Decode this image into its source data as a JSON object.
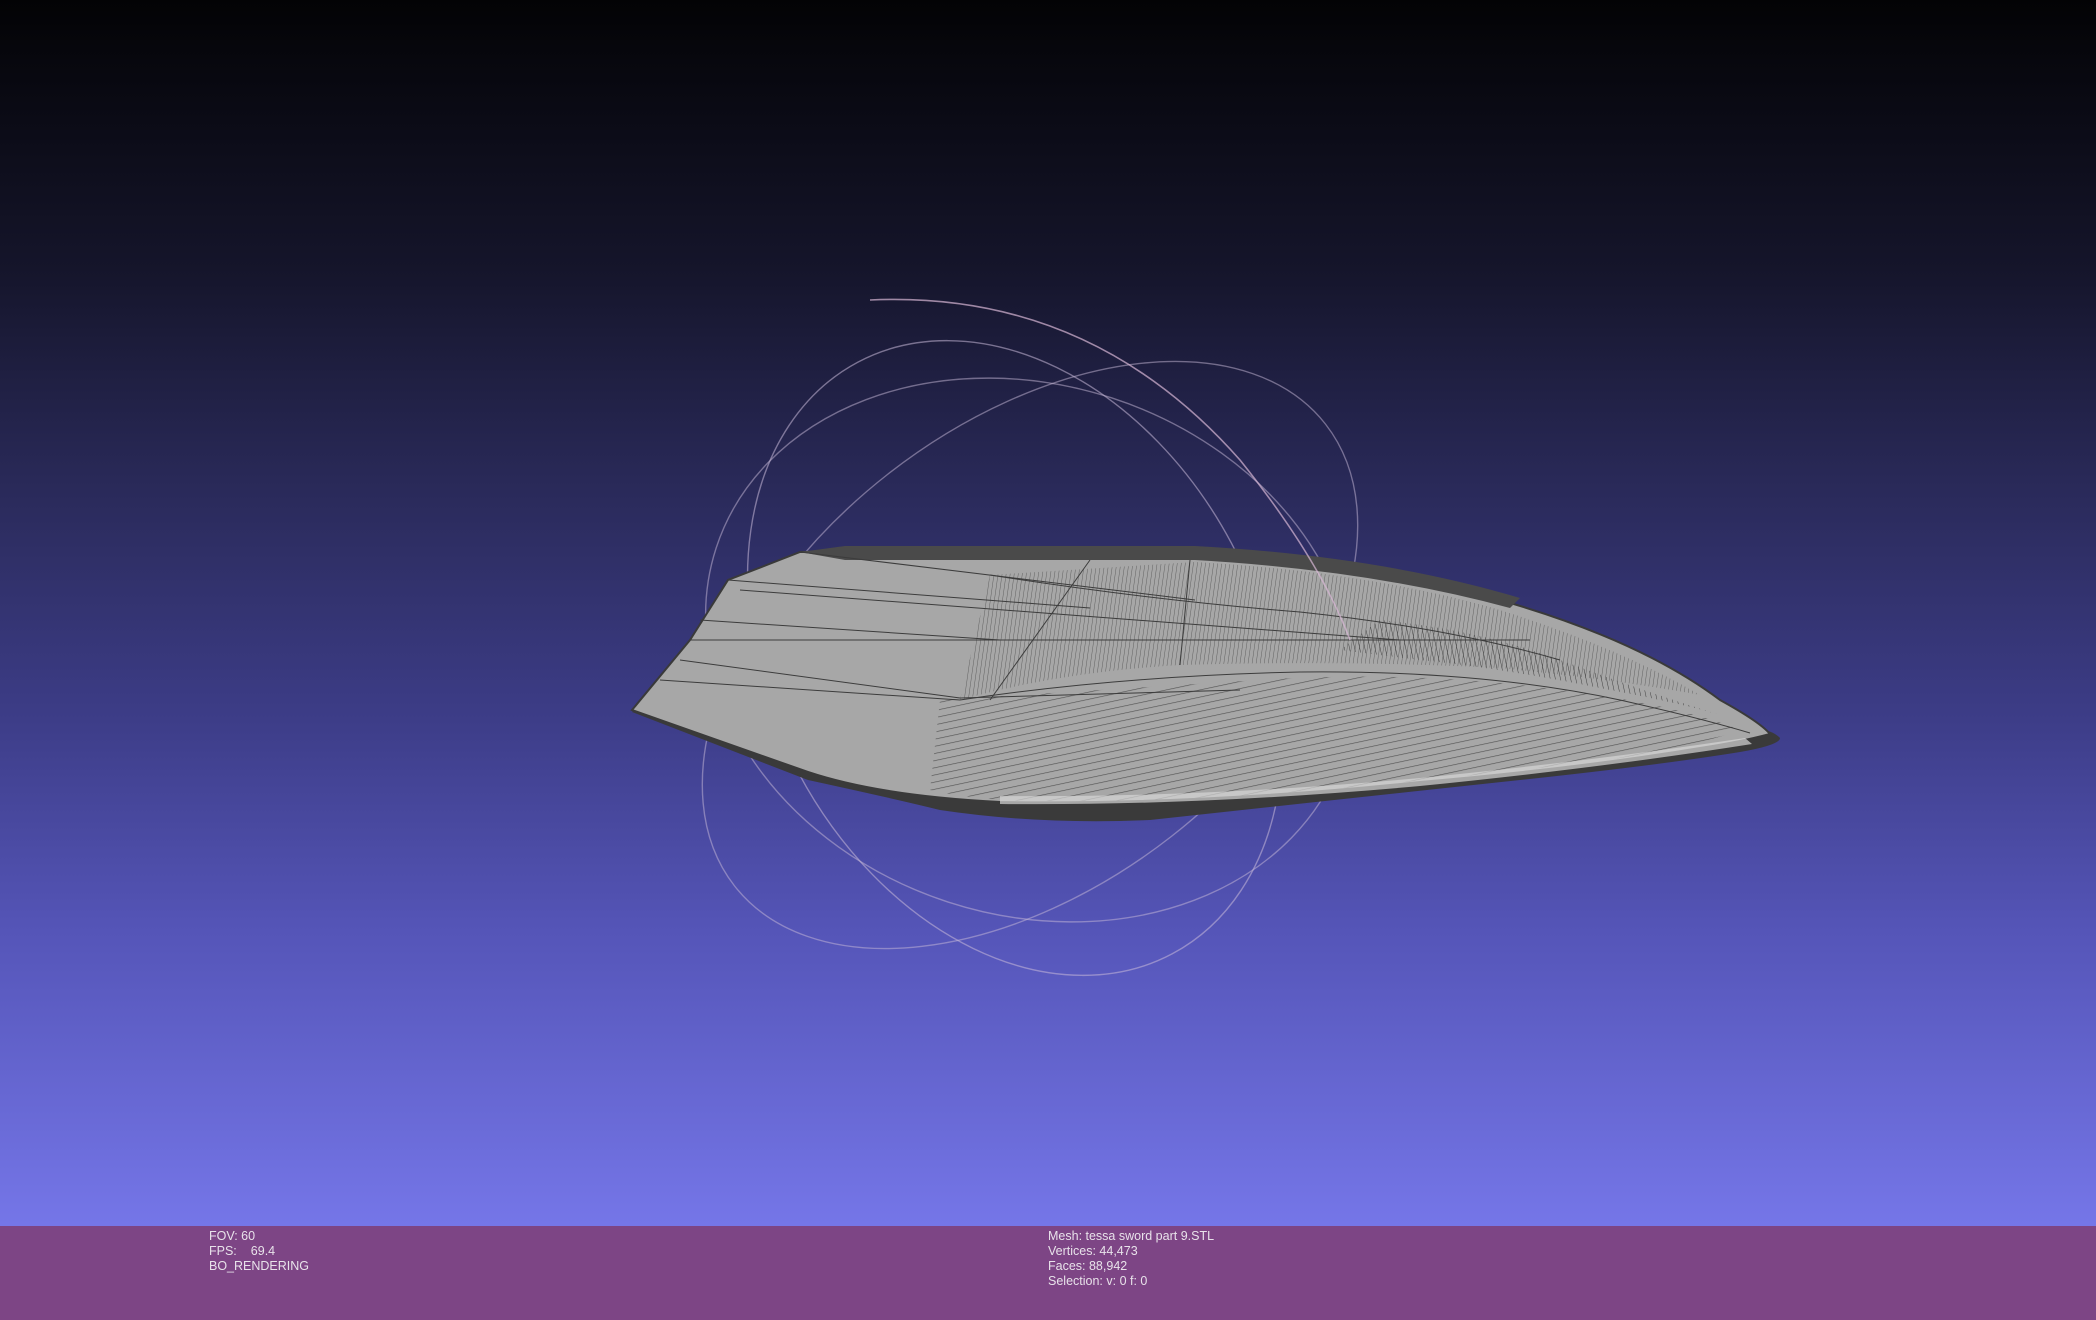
{
  "info_left": {
    "fov_label": "FOV: 60",
    "fps_label": "FPS:",
    "fps_value": "69.4",
    "render_mode": "BO_RENDERING"
  },
  "info_center": {
    "mesh": "Mesh: tessa sword part 9.STL",
    "vertices": "Vertices: 44,473",
    "faces": "Faces: 88,942",
    "selection": "Selection: v: 0 f: 0"
  },
  "colors": {
    "background_top": "#030305",
    "background_bottom": "#7576e8",
    "info_bar": "#7d4585",
    "mesh_fill": "#a8a8a8",
    "mesh_wire": "#3c3c3c",
    "trackball_ring": "#cbbad8"
  },
  "scene": {
    "model": "sword-blade-mesh",
    "overlay": "trackball"
  }
}
